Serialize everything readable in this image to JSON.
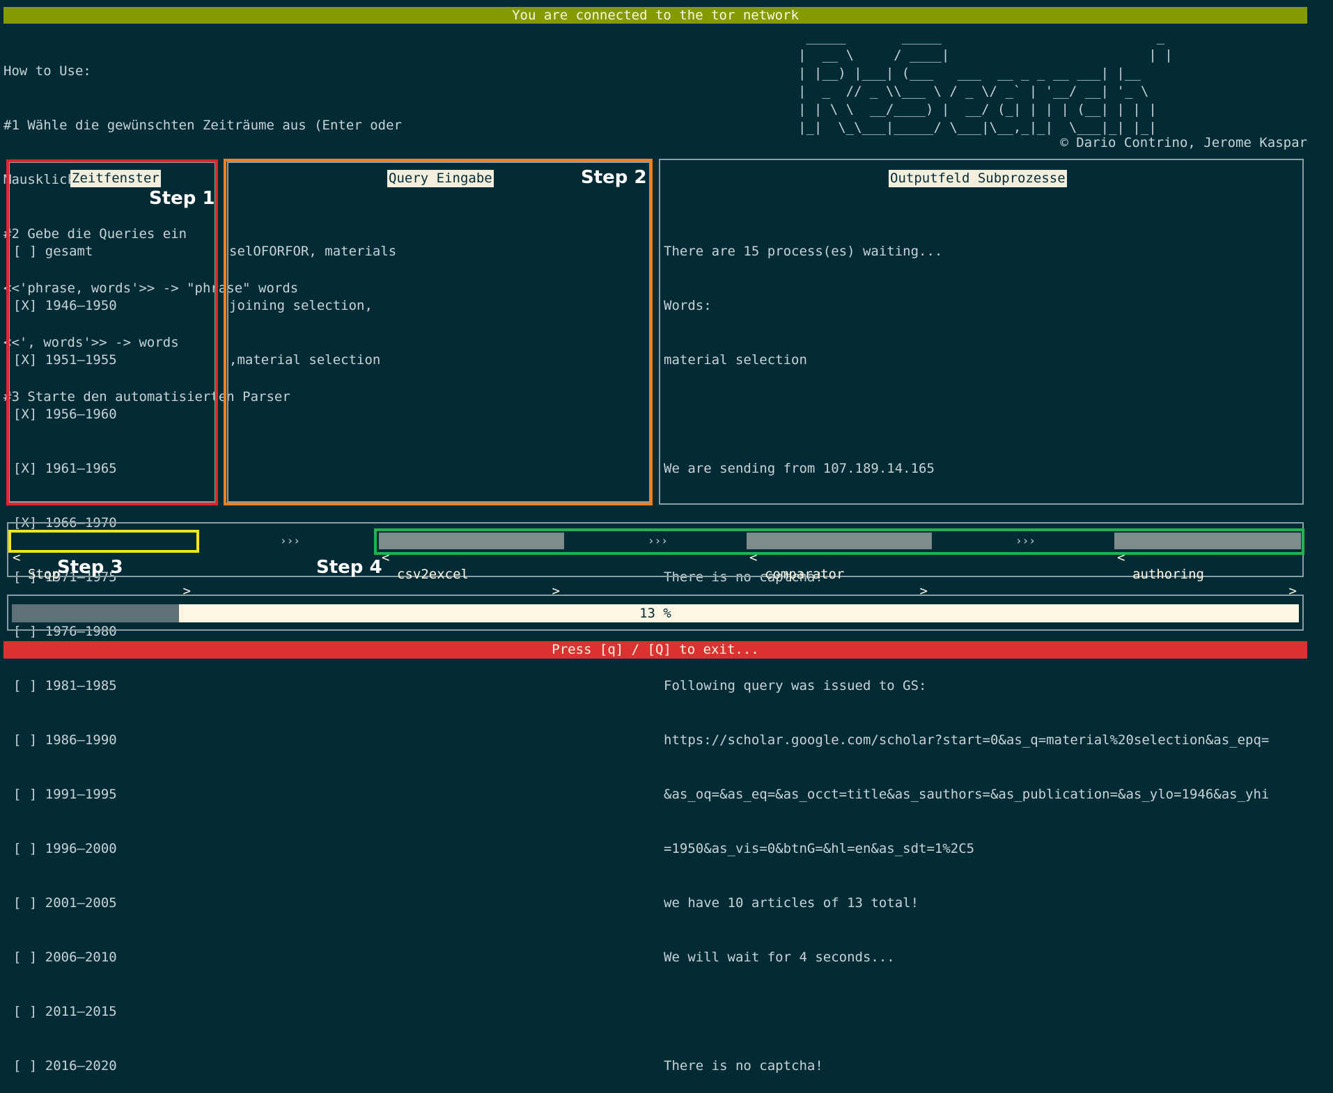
{
  "status_bar": "You are connected to the tor network",
  "how_to": [
    "How to Use:",
    "#1 Wähle die gewünschten Zeiträume aus (Enter oder",
    "Mausklick)",
    "#2 Gebe die Queries ein",
    "<<'phrase, words'>> -> \"phrase\" words",
    "<<', words'>> -> words",
    "#3 Starte den automatisierten Parser"
  ],
  "logo_ascii": " _____       _____                           _      \n|  __ \\     / ____|                         | |     \n| |__) |___| (___   ___  __ _ _ __ ___| |__   \n|  _  // _ \\\\___ \\ / _ \\/ _` | '__/ __| '_ \\  \n| | \\ \\  __/____) |  __/ (_| | | | (__| | | | \n|_|  \\_\\___|_____/ \\___|\\__,_|_|  \\___|_| |_| ",
  "copyright": "© Dario Contrino, Jerome Kaspar",
  "zeitfenster": {
    "title": "Zeitfenster",
    "items": [
      "[ ] gesamt",
      "[X] 1946–1950",
      "[X] 1951–1955",
      "[X] 1956–1960",
      "[X] 1961–1965",
      "[X] 1966–1970",
      "[ ] 1971–1975",
      "[ ] 1976–1980",
      "[ ] 1981–1985",
      "[ ] 1986–1990",
      "[ ] 1991–1995",
      "[ ] 1996–2000",
      "[ ] 2001–2005",
      "[ ] 2006–2010",
      "[ ] 2011–2015",
      "[ ] 2016–2020"
    ]
  },
  "query": {
    "title": "Query Eingabe",
    "lines": [
      "selOFORFOR, materials",
      "joining selection,",
      ",material selection"
    ]
  },
  "output": {
    "title": "Outputfeld Subprozesse",
    "lines": [
      "There are 15 process(es) waiting...",
      "Words:",
      "material selection",
      "",
      "We are sending from 107.189.14.165",
      "",
      "There is no captcha!",
      "",
      "Following query was issued to GS:",
      "https://scholar.google.com/scholar?start=0&as_q=material%20selection&as_epq=",
      "&as_oq=&as_eq=&as_occt=title&as_sauthors=&as_publication=&as_ylo=1946&as_yhi",
      "=1950&as_vis=0&btnG=&hl=en&as_sdt=1%2C5",
      "we have 10 articles of 13 total!",
      "We will wait for 4 seconds...",
      "",
      "There is no captcha!"
    ]
  },
  "steps": {
    "step1": "Step 1",
    "step2": "Step 2",
    "step3": "Step 3",
    "step4": "Step 4"
  },
  "buttons": {
    "bracket_left": "<",
    "bracket_right": ">",
    "stop": "Stop",
    "csv2excel": "csv2excel",
    "comparator": "comparator",
    "authoring": "authoring",
    "arrows": "›››"
  },
  "progress": {
    "value": 0.13,
    "label": "13 %"
  },
  "exit_bar": "Press [q] / [Q] to exit...",
  "colors": {
    "background": "#022b36",
    "status_bar": "#859a00",
    "exit_bar": "#dc3131",
    "step1_highlight": "#e8222b",
    "step2_highlight": "#f07f1f",
    "step3_highlight": "#f2e51b",
    "step4_highlight": "#1eb54a"
  }
}
